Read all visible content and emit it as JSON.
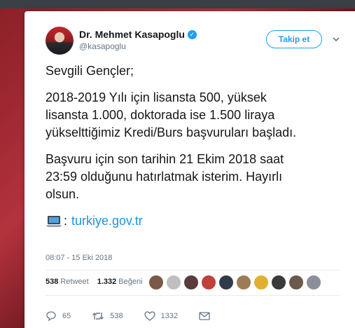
{
  "profile": {
    "name": "Dr. Mehmet Kasapoglu",
    "handle": "@kasapoglu",
    "verified_glyph": "✓"
  },
  "follow_button": "Takip et",
  "tweet": {
    "greeting": "Sevgili Gençler;",
    "paragraph1": "2018-2019 Yılı için lisansta 500, yüksek\nlisansta 1.000, doktorada ise 1.500 liraya\nyükselttiğimiz Kredi/Burs başvuruları başladı.",
    "paragraph2": "Başvuru için son tarihin 21 Ekim 2018 saat\n23:59 olduğunu hatırlatmak isterim. Hayırlı\nolsun.",
    "link_colon": ":",
    "link_text": "turkiye.gov.tr"
  },
  "timestamp": "08:07 - 15 Eki 2018",
  "stats": {
    "retweets_count": "538",
    "retweets_label": "Retweet",
    "likes_count": "1.332",
    "likes_label": "Beğeni"
  },
  "actions": {
    "replies": "65",
    "retweets": "538",
    "likes": "1332"
  },
  "colors": {
    "accent": "#1da1f2",
    "link": "#1b95e0"
  },
  "icons": [
    "verified-badge-icon",
    "chevron-down-icon",
    "laptop-icon",
    "reply-icon",
    "retweet-icon",
    "like-icon",
    "envelope-icon"
  ]
}
